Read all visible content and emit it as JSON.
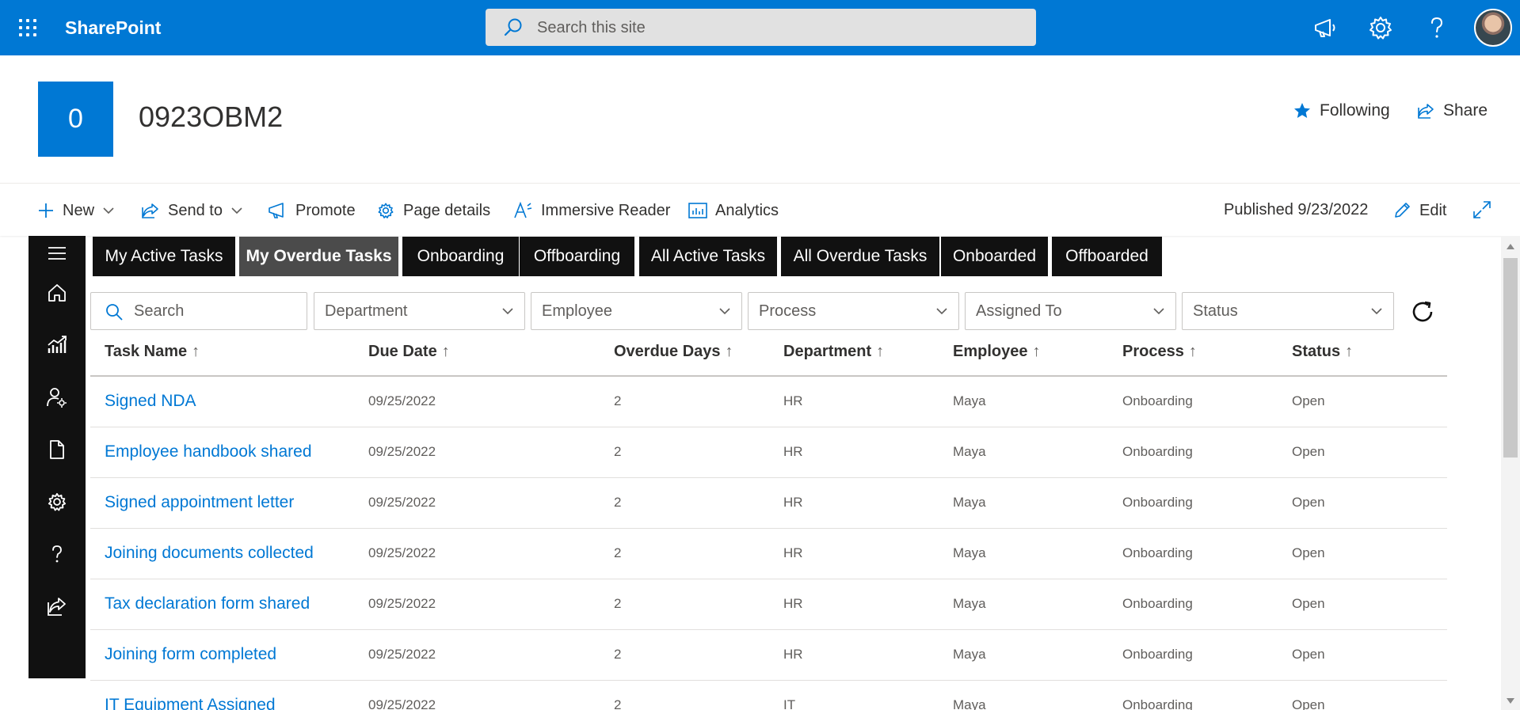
{
  "suite": {
    "app_name": "SharePoint",
    "search_placeholder": "Search this site"
  },
  "site": {
    "logo_letter": "0",
    "title": "0923OBM2",
    "following_label": "Following",
    "share_label": "Share"
  },
  "commands": {
    "new": "New",
    "send_to": "Send to",
    "promote": "Promote",
    "page_details": "Page details",
    "immersive_reader": "Immersive Reader",
    "analytics": "Analytics",
    "published": "Published 9/23/2022",
    "edit": "Edit"
  },
  "tabs": [
    {
      "label": "My Active Tasks"
    },
    {
      "label": "My Overdue Tasks"
    },
    {
      "label": "Onboarding"
    },
    {
      "label": "Offboarding"
    },
    {
      "label": "All Active Tasks"
    },
    {
      "label": "All Overdue Tasks"
    },
    {
      "label": "Onboarded"
    },
    {
      "label": "Offboarded"
    }
  ],
  "active_tab": "My Overdue Tasks",
  "filters": {
    "search_placeholder": "Search",
    "department": "Department",
    "employee": "Employee",
    "process": "Process",
    "assigned_to": "Assigned To",
    "status": "Status"
  },
  "table": {
    "columns": [
      "Task Name",
      "Due Date",
      "Overdue Days",
      "Department",
      "Employee",
      "Process",
      "Status"
    ],
    "sort_arrow": "↑",
    "rows": [
      [
        "Signed NDA",
        "09/25/2022",
        "2",
        "HR",
        "Maya",
        "Onboarding",
        "Open"
      ],
      [
        "Employee handbook shared",
        "09/25/2022",
        "2",
        "HR",
        "Maya",
        "Onboarding",
        "Open"
      ],
      [
        "Signed appointment letter",
        "09/25/2022",
        "2",
        "HR",
        "Maya",
        "Onboarding",
        "Open"
      ],
      [
        "Joining documents collected",
        "09/25/2022",
        "2",
        "HR",
        "Maya",
        "Onboarding",
        "Open"
      ],
      [
        "Tax declaration form shared",
        "09/25/2022",
        "2",
        "HR",
        "Maya",
        "Onboarding",
        "Open"
      ],
      [
        "Joining form completed",
        "09/25/2022",
        "2",
        "HR",
        "Maya",
        "Onboarding",
        "Open"
      ],
      [
        "IT Equipment Assigned",
        "09/25/2022",
        "2",
        "IT",
        "Maya",
        "Onboarding",
        "Open"
      ]
    ]
  },
  "colors": {
    "brand": "#0078d4",
    "rail": "#111111",
    "tab_active": "#4b4b4b",
    "link": "#0078d4"
  },
  "icons": {
    "waffle": "waffle-icon",
    "search": "search-icon",
    "megaphone": "megaphone-icon",
    "settings": "gear-icon",
    "help": "help-icon",
    "star": "star-icon",
    "share": "share-icon",
    "refresh": "refresh-icon"
  }
}
